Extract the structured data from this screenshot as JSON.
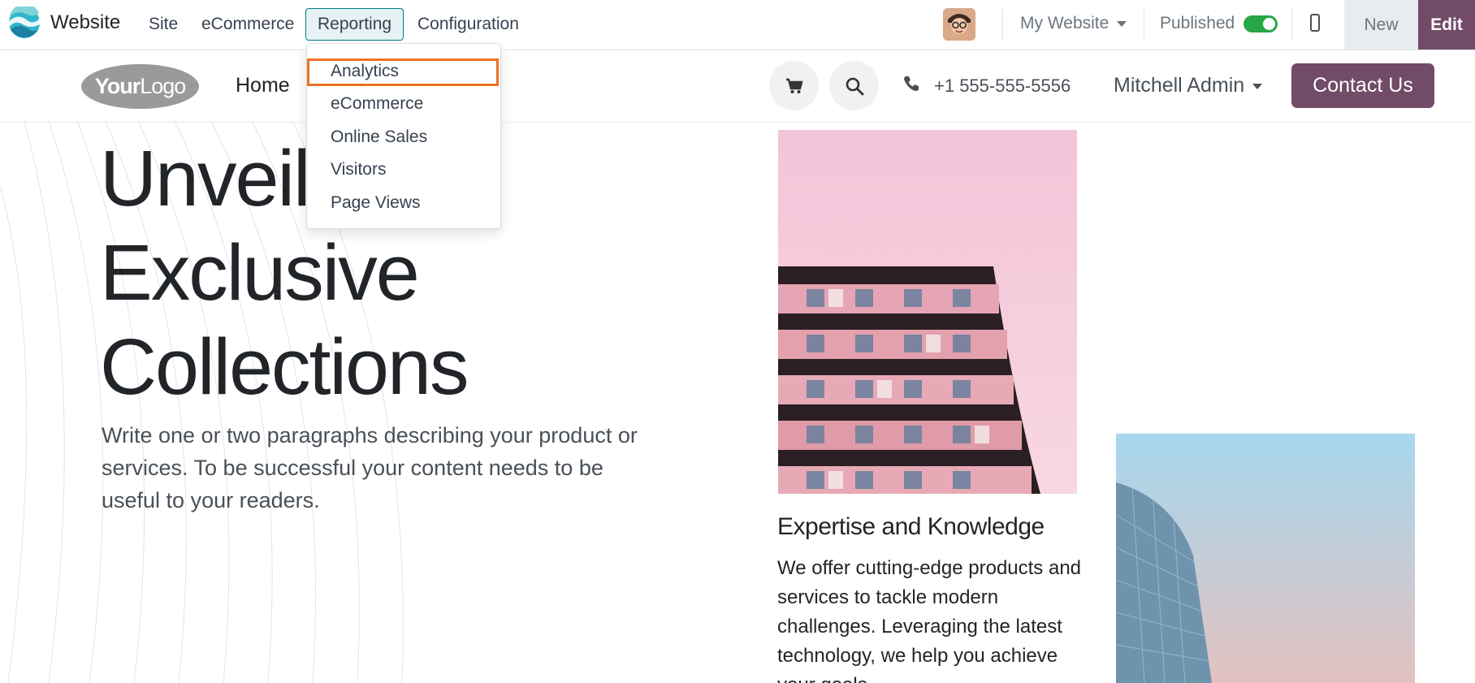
{
  "admin_bar": {
    "app_name": "Website",
    "menus": [
      {
        "label": "Site"
      },
      {
        "label": "eCommerce"
      },
      {
        "label": "Reporting"
      },
      {
        "label": "Configuration"
      }
    ],
    "website_selector": "My Website",
    "published_label": "Published",
    "published_on": true,
    "new_label": "New",
    "edit_label": "Edit",
    "icons": [
      "odoo-website-icon",
      "user-avatar",
      "mobile-preview-icon"
    ]
  },
  "reporting_dropdown": {
    "items": [
      {
        "label": "Analytics"
      },
      {
        "label": "eCommerce"
      },
      {
        "label": "Online Sales"
      },
      {
        "label": "Visitors"
      },
      {
        "label": "Page Views"
      }
    ],
    "highlighted": "Analytics"
  },
  "site_header": {
    "logo_text_bold": "Your",
    "logo_text": "Logo",
    "nav": [
      {
        "label": "Home"
      }
    ],
    "phone": "+1 555-555-5556",
    "user": "Mitchell Admin",
    "contact_label": "Contact Us",
    "icons": [
      "cart-icon",
      "search-icon",
      "phone-icon"
    ]
  },
  "hero": {
    "title_lines": [
      "Unveil",
      "Exclusive",
      "Collections"
    ],
    "description": "Write one or two paragraphs describing your product or services. To be successful your content needs to be useful to your readers."
  },
  "card": {
    "title": "Expertise and Knowledge",
    "text": "We offer cutting-edge products and services to tackle modern challenges. Leveraging the latest technology, we help you achieve your goals."
  },
  "colors": {
    "brand": "#714b67",
    "active_menu_border": "#017e84",
    "highlight": "#ee7125",
    "toggle_on": "#28a745"
  }
}
